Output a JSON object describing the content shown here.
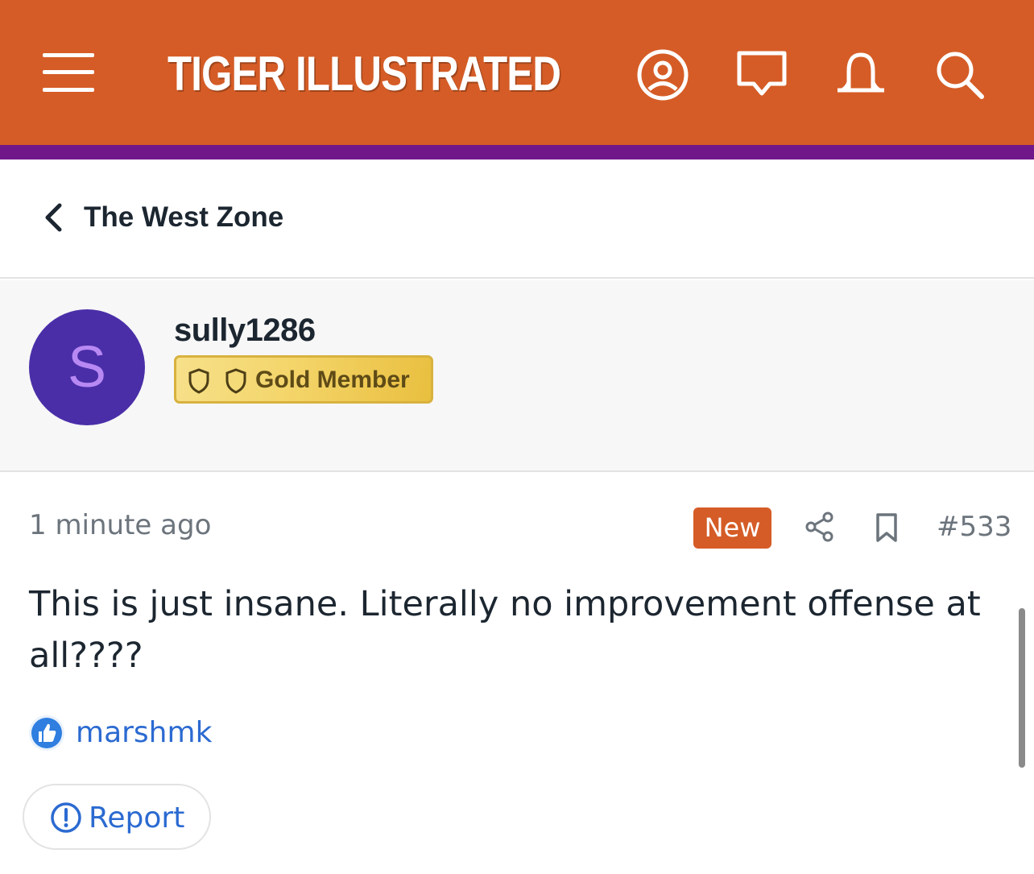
{
  "header": {
    "logo_text": "TIGER ILLUSTRATED",
    "icons": [
      "menu-icon",
      "account-icon",
      "messages-icon",
      "notifications-icon",
      "search-icon"
    ],
    "brand_color": "#d55c26",
    "accent_bar_color": "#70178a"
  },
  "nav": {
    "back_label": "The West Zone"
  },
  "author": {
    "avatar_letter": "S",
    "avatar_bg": "#4a2ea8",
    "username": "sully1286",
    "badge_label": "Gold Member"
  },
  "post": {
    "timestamp": "1 minute ago",
    "new_label": "New",
    "number": "#533",
    "body": "This is just insane. Literally no improvement offense at all????"
  },
  "reactions": {
    "liked_by": "marshmk"
  },
  "actions": {
    "report_label": "Report"
  }
}
